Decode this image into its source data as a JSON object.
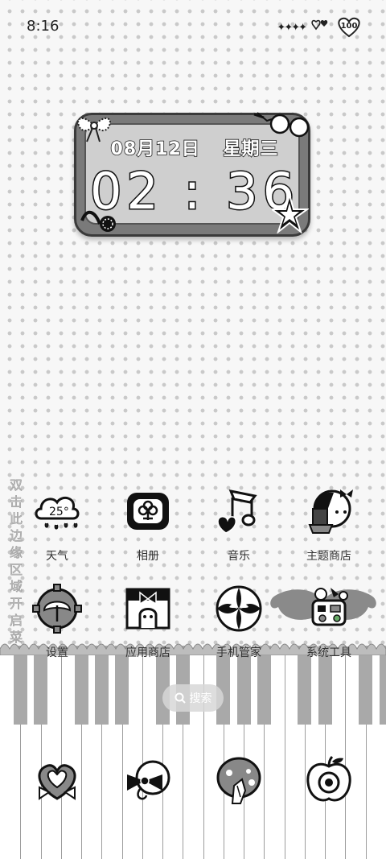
{
  "status_bar": {
    "time": "8:16",
    "signal_icons": "✦✦✦✦",
    "battery_level": "100"
  },
  "clock_widget": {
    "date": "08月12日",
    "weekday": "星期三",
    "time": "02 : 36"
  },
  "side_hint": "双击此边缘区域开启菜单",
  "apps_row1": [
    {
      "label": "天气",
      "icon": "weather-cloud-icon",
      "temp": "25°"
    },
    {
      "label": "相册",
      "icon": "gallery-flower-icon"
    },
    {
      "label": "音乐",
      "icon": "music-note-icon"
    },
    {
      "label": "主题商店",
      "icon": "theme-store-girl-icon"
    }
  ],
  "apps_row2": [
    {
      "label": "设置",
      "icon": "settings-gear-icon"
    },
    {
      "label": "应用商店",
      "icon": "app-store-house-icon"
    },
    {
      "label": "手机管家",
      "icon": "phone-manager-icon"
    },
    {
      "label": "系统工具",
      "icon": "system-tools-folder-icon"
    }
  ],
  "search": {
    "label": "搜索"
  },
  "dock": [
    {
      "icon": "heart-bow-icon"
    },
    {
      "icon": "camera-bow-icon"
    },
    {
      "icon": "cookie-leaf-icon"
    },
    {
      "icon": "apple-target-icon"
    }
  ],
  "colors": {
    "dot_pattern": "#c9c9c9",
    "widget_frame": "#7a7a7a",
    "piano_black_key": "#a9a9a9"
  }
}
